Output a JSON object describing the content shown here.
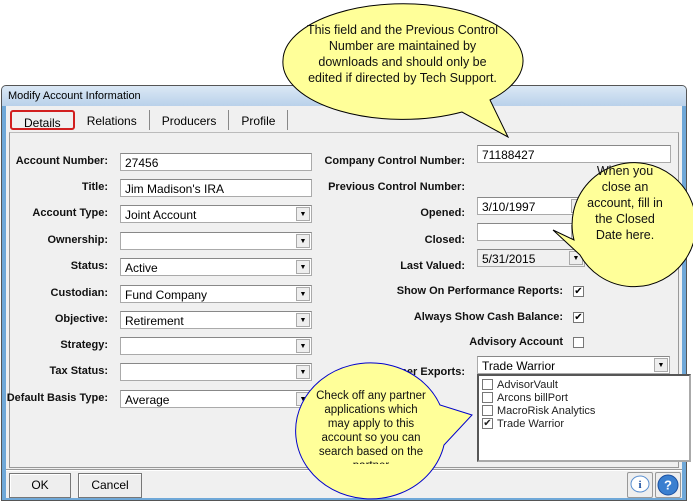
{
  "window": {
    "title": "Modify Account Information"
  },
  "tabs": [
    {
      "label": "Details",
      "active": true
    },
    {
      "label": "Relations"
    },
    {
      "label": "Producers"
    },
    {
      "label": "Profile"
    }
  ],
  "left_fields": [
    {
      "label": "Account Number:",
      "value": "27456",
      "type": "text"
    },
    {
      "label": "Title:",
      "value": "Jim Madison's IRA",
      "type": "text"
    },
    {
      "label": "Account Type:",
      "value": "Joint Account",
      "type": "select"
    },
    {
      "label": "Ownership:",
      "value": "",
      "type": "select"
    },
    {
      "label": "Status:",
      "value": "Active",
      "type": "select"
    },
    {
      "label": "Custodian:",
      "value": "Fund Company",
      "type": "select"
    },
    {
      "label": "Objective:",
      "value": "Retirement",
      "type": "select"
    },
    {
      "label": "Strategy:",
      "value": "",
      "type": "select"
    },
    {
      "label": "Tax Status:",
      "value": "",
      "type": "select"
    },
    {
      "label": "Default Basis Type:",
      "value": "Average",
      "type": "select"
    }
  ],
  "right_fields": {
    "company_control": {
      "label": "Company Control Number:",
      "value": "71188427"
    },
    "previous_control": {
      "label": "Previous Control Number:"
    },
    "opened": {
      "label": "Opened:",
      "value": "3/10/1997"
    },
    "closed": {
      "label": "Closed:",
      "value": ""
    },
    "last_valued": {
      "label": "Last Valued:",
      "value": "5/31/2015"
    },
    "show_on_reports": {
      "label": "Show On Performance Reports:",
      "checked": true
    },
    "show_cash": {
      "label": "Always Show Cash Balance:",
      "checked": true
    },
    "advisory": {
      "label": "Advisory Account",
      "checked": false
    },
    "partner_exports": {
      "label": "Partner Exports:",
      "value": "Trade Warrior"
    }
  },
  "partners": [
    {
      "label": "AdvisorVault",
      "checked": false
    },
    {
      "label": "Arcons billPort",
      "checked": false
    },
    {
      "label": "MacroRisk Analytics",
      "checked": false
    },
    {
      "label": "Trade Warrior",
      "checked": true
    }
  ],
  "buttons": {
    "ok": "OK",
    "cancel": "Cancel"
  },
  "callouts": {
    "control": "This field and the Previous Control Number are maintained by downloads and should only be edited if directed by Tech Support.",
    "closed": "When you close an account, fill in the Closed Date here.",
    "partner": "Check off any partner applications which may apply to this account so you can search based on the partner"
  },
  "colors": {
    "callout_fill": "#ffff99",
    "tab_highlight": "#d21f1f",
    "partner_callout_border": "#0000cc"
  }
}
